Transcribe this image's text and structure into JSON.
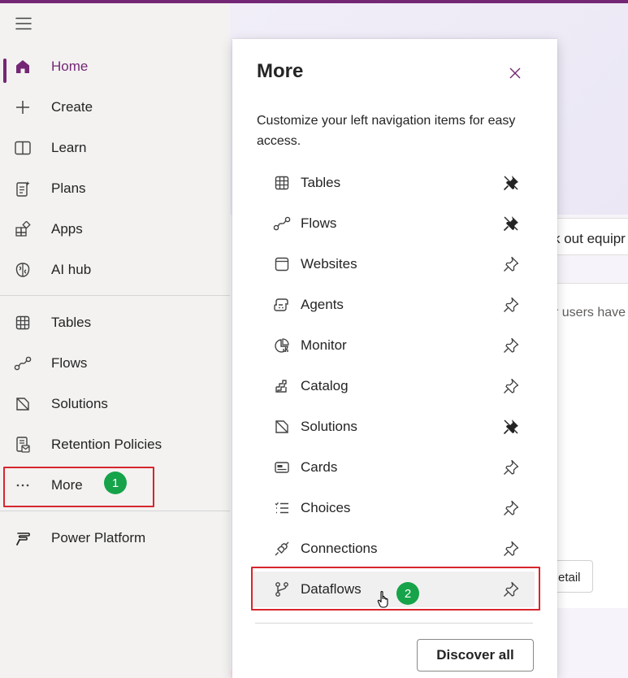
{
  "sidebar": {
    "items": [
      {
        "label": "Home",
        "icon": "home-icon",
        "active": true
      },
      {
        "label": "Create",
        "icon": "plus-icon"
      },
      {
        "label": "Learn",
        "icon": "book-icon"
      },
      {
        "label": "Plans",
        "icon": "plans-icon"
      },
      {
        "label": "Apps",
        "icon": "apps-icon"
      },
      {
        "label": "AI hub",
        "icon": "ai-hub-icon"
      }
    ],
    "pinned": [
      {
        "label": "Tables",
        "icon": "table-icon"
      },
      {
        "label": "Flows",
        "icon": "flows-icon"
      },
      {
        "label": "Solutions",
        "icon": "solutions-icon"
      },
      {
        "label": "Retention Policies",
        "icon": "retention-icon"
      }
    ],
    "more": {
      "label": "More",
      "icon": "ellipsis-icon",
      "badge": "1"
    },
    "platform": {
      "label": "Power Platform",
      "icon": "power-platform-icon"
    }
  },
  "flyout": {
    "title": "More",
    "description": "Customize your left navigation items for easy access.",
    "items": [
      {
        "label": "Tables",
        "icon": "table-icon",
        "pinned": true
      },
      {
        "label": "Flows",
        "icon": "flows-icon",
        "pinned": true
      },
      {
        "label": "Websites",
        "icon": "websites-icon",
        "pinned": false
      },
      {
        "label": "Agents",
        "icon": "agents-icon",
        "pinned": false
      },
      {
        "label": "Monitor",
        "icon": "monitor-icon",
        "pinned": false
      },
      {
        "label": "Catalog",
        "icon": "catalog-icon",
        "pinned": false
      },
      {
        "label": "Solutions",
        "icon": "solutions-icon",
        "pinned": true
      },
      {
        "label": "Cards",
        "icon": "cards-icon",
        "pinned": false
      },
      {
        "label": "Choices",
        "icon": "choices-icon",
        "pinned": false
      },
      {
        "label": "Connections",
        "icon": "connections-icon",
        "pinned": false
      },
      {
        "label": "Dataflows",
        "icon": "dataflows-icon",
        "pinned": false,
        "badge": "2"
      }
    ],
    "discover_label": "Discover all"
  },
  "background": {
    "card_text": "k out equipr",
    "panel_text": "r users have",
    "detail_label": "etail"
  },
  "colors": {
    "accent": "#742774",
    "callout": "#d7262d",
    "badge": "#16a34a"
  }
}
